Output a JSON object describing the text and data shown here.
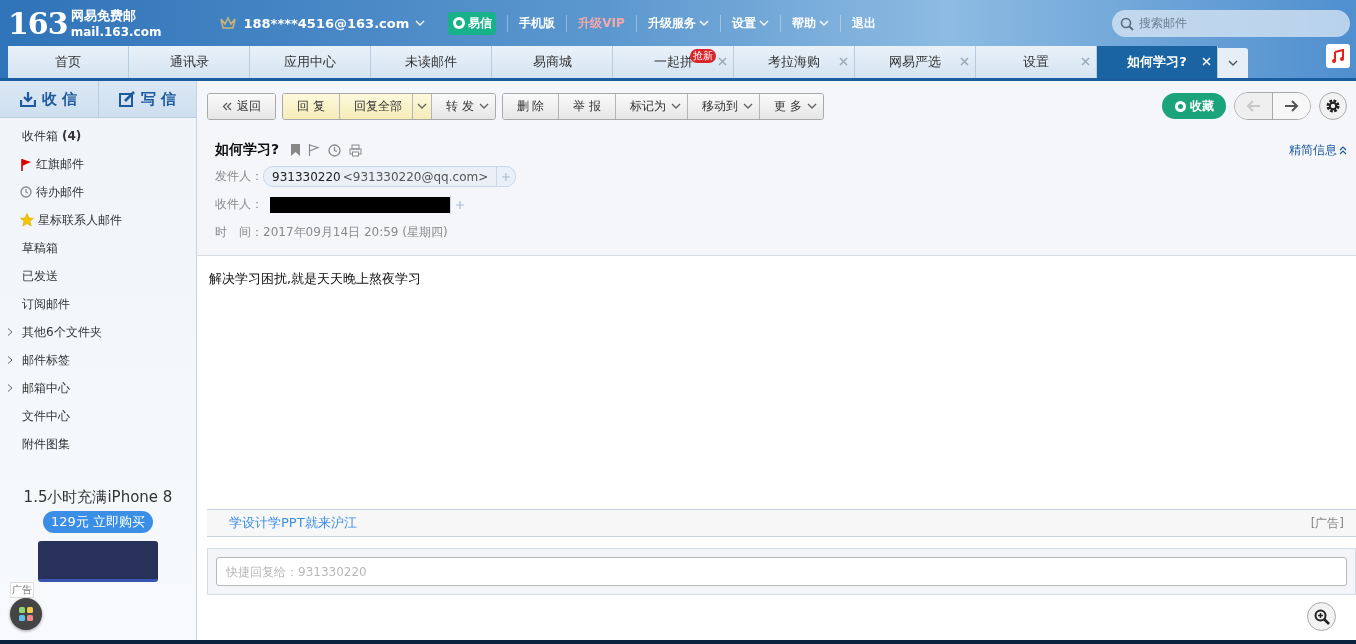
{
  "logo": {
    "number": "163",
    "name": "网易免费邮",
    "domain": "mail.163.com"
  },
  "account": "188****4516@163.com",
  "top_links": [
    {
      "label": "易信",
      "kind": "badge"
    },
    {
      "label": "手机版",
      "kind": "plain"
    },
    {
      "label": "升级VIP",
      "kind": "vip"
    },
    {
      "label": "升级服务",
      "kind": "menu"
    },
    {
      "label": "设置",
      "kind": "menu"
    },
    {
      "label": "帮助",
      "kind": "menu"
    },
    {
      "label": "退出",
      "kind": "plain"
    }
  ],
  "search": {
    "placeholder": "搜索邮件"
  },
  "tabs": [
    {
      "label": "首页",
      "selected": false,
      "closable": false
    },
    {
      "label": "通讯录",
      "selected": false,
      "closable": false
    },
    {
      "label": "应用中心",
      "selected": false,
      "closable": false
    },
    {
      "label": "未读邮件",
      "selected": false,
      "closable": false
    },
    {
      "label": "易商城",
      "selected": false,
      "closable": false
    },
    {
      "label": "一起拼",
      "badge": "抢新",
      "selected": false,
      "closable": true
    },
    {
      "label": "考拉海购",
      "selected": false,
      "closable": true
    },
    {
      "label": "网易严选",
      "selected": false,
      "closable": true
    },
    {
      "label": "设置",
      "selected": false,
      "closable": true
    },
    {
      "label": "如何学习?",
      "selected": true,
      "closable": true
    }
  ],
  "sidebar": {
    "actions": [
      {
        "label": "收 信",
        "kind": "receive"
      },
      {
        "label": "写 信",
        "kind": "compose"
      }
    ],
    "folders": [
      {
        "label": "收件箱",
        "count": "(4)",
        "kind": "plain"
      },
      {
        "label": "红旗邮件",
        "kind": "flag"
      },
      {
        "label": "待办邮件",
        "kind": "clock"
      },
      {
        "label": "星标联系人邮件",
        "kind": "star"
      },
      {
        "label": "草稿箱",
        "kind": "plain"
      },
      {
        "label": "已发送",
        "kind": "plain"
      },
      {
        "label": "订阅邮件",
        "kind": "plain"
      },
      {
        "label": "其他6个文件夹",
        "kind": "group",
        "expanded": false
      },
      {
        "label": "邮件标签",
        "kind": "group",
        "expanded": false
      },
      {
        "label": "邮箱中心",
        "kind": "group",
        "expanded": false
      },
      {
        "label": "文件中心",
        "kind": "plain"
      },
      {
        "label": "附件图集",
        "kind": "plain"
      }
    ]
  },
  "side_ad": {
    "headline": "1.5小时充满iPhone 8",
    "button": "129元 立即购买",
    "tag": "广告"
  },
  "toolbar": {
    "groups": [
      [
        {
          "label": "返回",
          "kind": "back"
        }
      ],
      [
        {
          "label": "回 复",
          "kind": "reply",
          "dropdown": false
        },
        {
          "label": "回复全部",
          "kind": "reply",
          "dropdown": true
        },
        {
          "label": "转 发",
          "kind": "plain",
          "dropdown": true
        }
      ],
      [
        {
          "label": "删 除",
          "kind": "plain",
          "dropdown": false
        },
        {
          "label": "举 报",
          "kind": "plain",
          "dropdown": false
        },
        {
          "label": "标记为",
          "kind": "plain",
          "dropdown": true
        },
        {
          "label": "移动到",
          "kind": "plain",
          "dropdown": true
        },
        {
          "label": "更 多",
          "kind": "plain",
          "dropdown": true
        }
      ]
    ],
    "collect": "收藏",
    "prev_disabled": true,
    "next_disabled": false
  },
  "message": {
    "subject": "如何学习?",
    "toggle": "精简信息",
    "sender_label": "发件人：",
    "sender_name": "931330220",
    "sender_address": "<931330220@qq.com>",
    "recipient_label": "收件人：",
    "recipient_redacted": true,
    "time_label": "时　间：",
    "time": "2017年09月14日 20:59 (星期四)",
    "body": "解决学习困扰,就是天天晚上熬夜学习"
  },
  "ad_bar": {
    "link": "学设计学PPT就来沪江",
    "tag": "[广告]"
  },
  "quick_reply": {
    "placeholder": "快捷回复给：931330220"
  }
}
